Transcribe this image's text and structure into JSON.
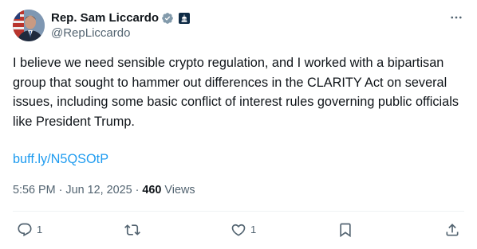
{
  "author": {
    "display_name": "Rep. Sam Liccardo",
    "handle": "@RepLiccardo",
    "badges": [
      "verified-gray-badge",
      "government-affiliation-badge"
    ]
  },
  "tweet": {
    "text": "I believe we need sensible crypto regulation, and I worked with a bipartisan group that sought to hammer out differences in the CLARITY Act on several issues, including some basic conflict of interest rules governing public officials like President Trump.",
    "link": "buff.ly/N5QSOtP",
    "time": "5:56 PM",
    "date": "Jun 12, 2025",
    "separator": "·",
    "views_count": "460",
    "views_label": "Views"
  },
  "actions": {
    "reply_count": "1",
    "repost_count": "",
    "like_count": "1"
  },
  "colors": {
    "text": "#0f1419",
    "secondary": "#536471",
    "link": "#1d9bf0",
    "divider": "#eff3f4"
  },
  "icons": [
    "more-icon",
    "reply-icon",
    "repost-icon",
    "like-icon",
    "bookmark-icon",
    "share-icon"
  ]
}
